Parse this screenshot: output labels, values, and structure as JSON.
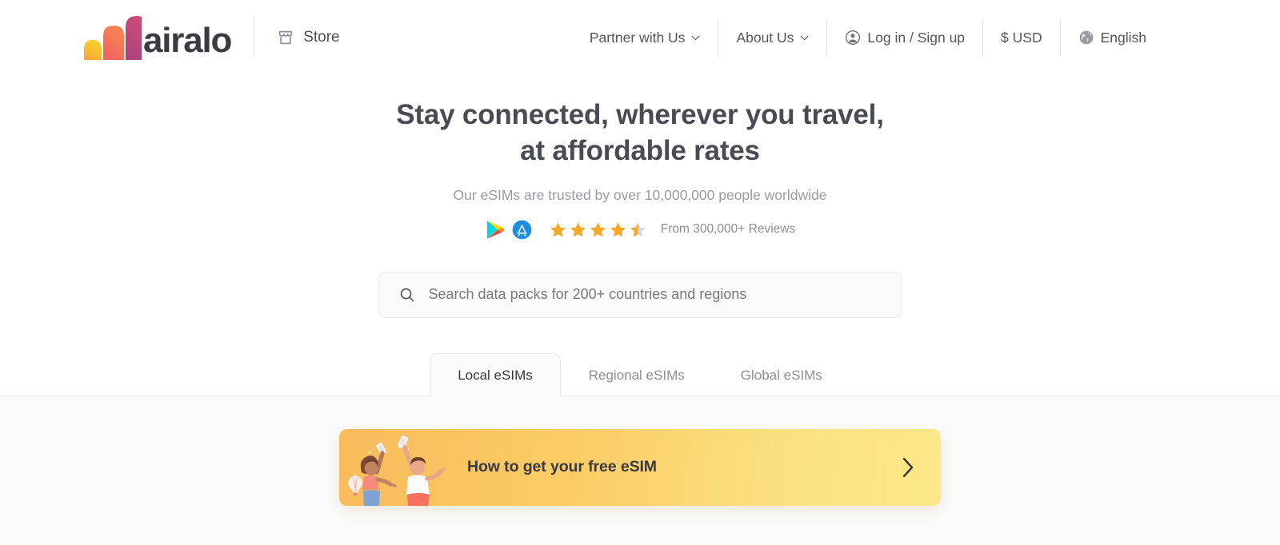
{
  "brand": {
    "name": "airalo",
    "logo_colors": [
      "#f9c22e",
      "#f2705f",
      "#b8457e"
    ]
  },
  "header": {
    "store_label": "Store",
    "store_icon": "storefront-icon",
    "nav": [
      {
        "label": "Partner with Us",
        "icon": "chevron-down-icon",
        "has_caret": true
      },
      {
        "label": "About Us",
        "icon": "chevron-down-icon",
        "has_caret": true
      },
      {
        "label": "Log in / Sign up",
        "icon": "user-account-icon",
        "has_caret": false
      },
      {
        "label": "$ USD",
        "icon": "",
        "has_caret": false
      },
      {
        "label": "English",
        "icon": "globe-icon",
        "has_caret": false
      }
    ]
  },
  "hero": {
    "title_line_1": "Stay connected, wherever you travel,",
    "title_line_2": "at affordable rates",
    "subtitle": "Our eSIMs are trusted by over 10,000,000 people worldwide"
  },
  "rating": {
    "google_play_icon": "google-play-icon",
    "app_store_icon": "app-store-icon",
    "stars_filled": 4,
    "stars_half": 1,
    "stars_total": 5,
    "star_color": "#f7a928",
    "star_empty_color": "#d9d9dd",
    "reviews_text": "From 300,000+ Reviews"
  },
  "search": {
    "icon": "search-icon",
    "placeholder": "Search data packs for 200+ countries and regions",
    "value": ""
  },
  "tabs": {
    "active_index": 0,
    "items": [
      {
        "label": "Local eSIMs"
      },
      {
        "label": "Regional eSIMs"
      },
      {
        "label": "Global eSIMs"
      }
    ]
  },
  "promo": {
    "title": "How to get your free eSIM",
    "chevron_icon": "chevron-right-icon",
    "gradient_start": "#f8bb5c",
    "gradient_end": "#fce889",
    "illustration": "two-people-celebrating-with-phones"
  }
}
